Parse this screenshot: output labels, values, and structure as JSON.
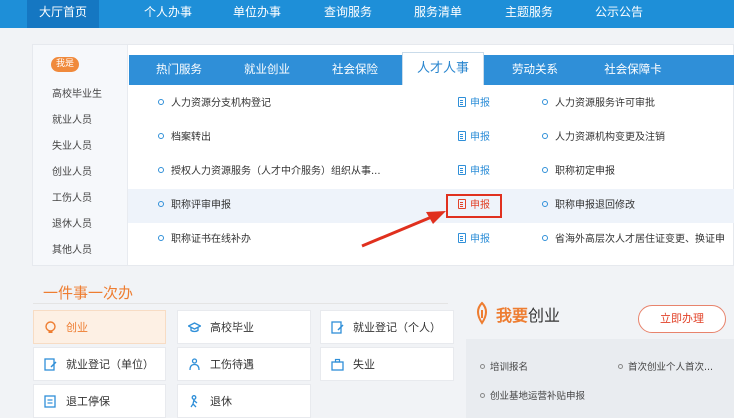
{
  "nav": {
    "items": [
      "大厅首页",
      "个人办事",
      "单位办事",
      "查询服务",
      "服务清单",
      "主题服务",
      "公示公告"
    ]
  },
  "sidebar": {
    "badge": "我是",
    "items": [
      "高校毕业生",
      "就业人员",
      "失业人员",
      "创业人员",
      "工伤人员",
      "退休人员",
      "其他人员"
    ]
  },
  "tabs": [
    "热门服务",
    "就业创业",
    "社会保险",
    "人才人事",
    "劳动关系",
    "社会保障卡"
  ],
  "services": {
    "rows": [
      {
        "left": "人力资源分支机构登记",
        "apply": "申报",
        "right": "人力资源服务许可审批"
      },
      {
        "left": "档案转出",
        "apply": "申报",
        "right": "人力资源机构变更及注销"
      },
      {
        "left": "授权人力资源服务（人才中介服务）组织从事...",
        "apply": "申报",
        "right": "职称初定申报"
      },
      {
        "left": "职称评审申报",
        "apply": "申报",
        "right": "职称申报退回修改"
      },
      {
        "left": "职称证书在线补办",
        "apply": "申报",
        "right": "省海外高层次人才居住证变更、换证申"
      }
    ]
  },
  "lower": {
    "title": "一件事一次办",
    "grid": [
      {
        "label": "创业",
        "icon": "bulb-icon"
      },
      {
        "label": "高校毕业",
        "icon": "graduation-cap-icon"
      },
      {
        "label": "就业登记（个人）",
        "icon": "edit-doc-icon"
      },
      {
        "label": "就业登记（单位）",
        "icon": "edit-doc-icon"
      },
      {
        "label": "工伤待遇",
        "icon": "injured-person-icon"
      },
      {
        "label": "失业",
        "icon": "briefcase-icon"
      },
      {
        "label": "退工停保",
        "icon": "stop-doc-icon"
      },
      {
        "label": "退休",
        "icon": "elderly-person-icon"
      }
    ]
  },
  "startup": {
    "title_em": "我要",
    "title_rest": "创业",
    "button": "立即办理",
    "items": [
      "培训报名",
      "创业基地运营补贴申报",
      "首次创业个人首次..."
    ]
  },
  "colors": {
    "nav_blue": "#1e8fd8",
    "tab_blue": "#2f8fd8",
    "accent_orange": "#ee7d31",
    "highlight_red": "#e0301e"
  }
}
